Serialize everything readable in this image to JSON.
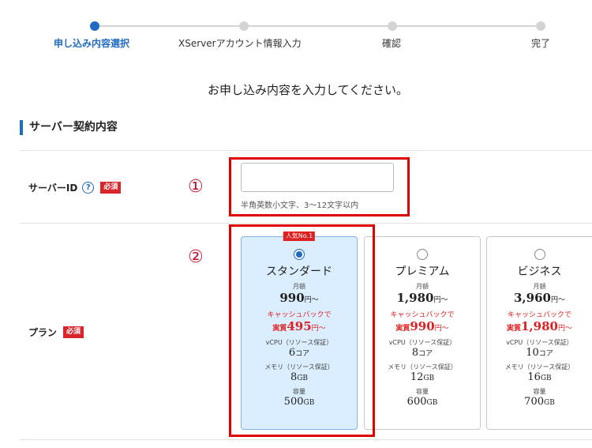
{
  "stepper": {
    "steps": [
      {
        "label": "申し込み内容選択",
        "active": true
      },
      {
        "label": "XServerアカウント情報入力",
        "active": false
      },
      {
        "label": "確認",
        "active": false
      },
      {
        "label": "完了",
        "active": false
      }
    ]
  },
  "lead_text": "お申し込み内容を入力してください。",
  "section_title": "サーバー契約内容",
  "server_id": {
    "label": "サーバーID",
    "help": "?",
    "required": "必須",
    "value": "",
    "note": "半角英数小文字、3～12文字以内"
  },
  "annotations": {
    "one": "①",
    "two": "②"
  },
  "plan": {
    "label": "プラン",
    "required": "必須",
    "cards": [
      {
        "badge": "人気No.1",
        "name": "スタンダード",
        "monthly_label": "月額",
        "price": "990",
        "price_unit": "円～",
        "cashback": "キャッシュバックで",
        "real_prefix": "実質",
        "real_price": "495",
        "real_unit": "円～",
        "cpu_label": "vCPU（リソース保証）",
        "cpu_value": "6",
        "cpu_unit": "コア",
        "mem_label": "メモリ（リソース保証）",
        "mem_value": "8",
        "mem_unit": "GB",
        "disk_label": "容量",
        "disk_value": "500",
        "disk_unit": "GB",
        "selected": true
      },
      {
        "badge": "",
        "name": "プレミアム",
        "monthly_label": "月額",
        "price": "1,980",
        "price_unit": "円～",
        "cashback": "キャッシュバックで",
        "real_prefix": "実質",
        "real_price": "990",
        "real_unit": "円～",
        "cpu_label": "vCPU（リソース保証）",
        "cpu_value": "8",
        "cpu_unit": "コア",
        "mem_label": "メモリ（リソース保証）",
        "mem_value": "12",
        "mem_unit": "GB",
        "disk_label": "容量",
        "disk_value": "600",
        "disk_unit": "GB",
        "selected": false
      },
      {
        "badge": "",
        "name": "ビジネス",
        "monthly_label": "月額",
        "price": "3,960",
        "price_unit": "円～",
        "cashback": "キャッシュバックで",
        "real_prefix": "実質",
        "real_price": "1,980",
        "real_unit": "円～",
        "cpu_label": "vCPU（リソース保証）",
        "cpu_value": "10",
        "cpu_unit": "コア",
        "mem_label": "メモリ（リソース保証）",
        "mem_value": "16",
        "mem_unit": "GB",
        "disk_label": "容量",
        "disk_value": "700",
        "disk_unit": "GB",
        "selected": false
      }
    ]
  },
  "colors": {
    "accent": "#1f6bc4",
    "required": "#d8262c",
    "highlight": "#e00000",
    "selected_bg": "#dbeeff"
  }
}
